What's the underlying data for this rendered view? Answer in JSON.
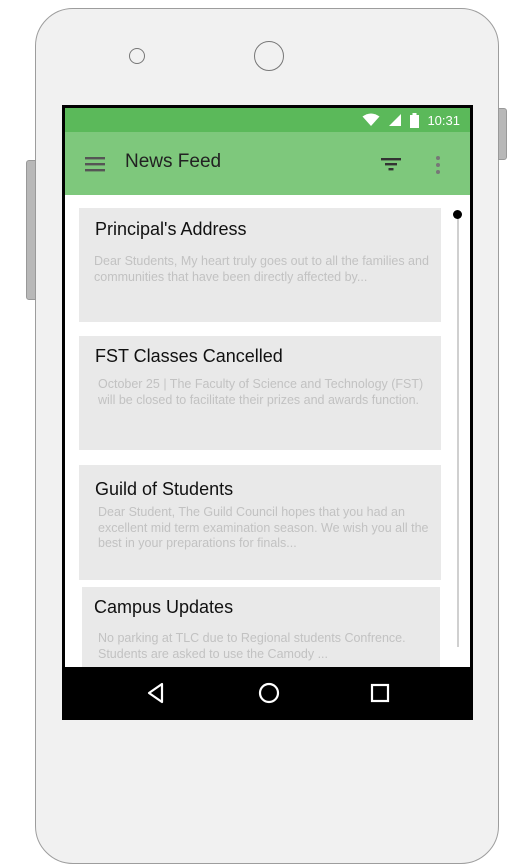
{
  "status_bar": {
    "time": "10:31"
  },
  "app_bar": {
    "title": "News Feed"
  },
  "feed": [
    {
      "title": "Principal's Address",
      "snippet": "Dear Students,      My heart truly goes out to all the families and communities that have been directly affected by..."
    },
    {
      "title": "FST Classes Cancelled",
      "snippet": "October 25 |  The Faculty of Science and Technology (FST) will be closed to facilitate their prizes and awards function."
    },
    {
      "title": "Guild of Students",
      "snippet": "Dear Student,     The Guild Council hopes that you had an excellent mid term examination season. We wish you all the best in your preparations for finals..."
    },
    {
      "title": "Campus Updates",
      "snippet": "No parking at TLC due to Regional students Confrence. Students are asked to use the Camody ..."
    }
  ],
  "icons": {
    "status": [
      "wifi-icon",
      "signal-icon",
      "battery-icon"
    ],
    "app_bar": [
      "menu-icon",
      "filter-icon",
      "more-vert-icon"
    ],
    "nav": [
      "back-icon",
      "home-icon",
      "recents-icon"
    ]
  },
  "colors": {
    "status_bar": "#5bb95a",
    "app_bar": "#7ec87c",
    "card_background": "#e9e9e9",
    "snippet_text": "#c2c2c2"
  }
}
